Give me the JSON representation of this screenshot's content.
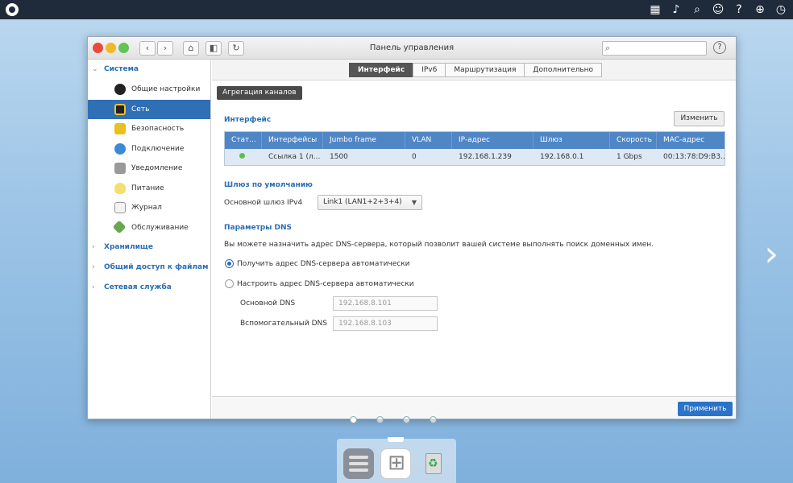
{
  "topbar": {
    "icons": [
      "apps-grid-icon",
      "bell-icon",
      "search-icon",
      "user-icon",
      "help-icon",
      "globe-icon",
      "dashboard-icon"
    ]
  },
  "window": {
    "title": "Панель управления",
    "search_placeholder": "",
    "help_label": "?"
  },
  "sidebar": {
    "groups": [
      {
        "label": "Система",
        "expanded": true
      },
      {
        "label": "Хранилище"
      },
      {
        "label": "Общий доступ к файлам"
      },
      {
        "label": "Сетевая служба"
      }
    ],
    "items": [
      {
        "label": "Общие настройки",
        "icon": "gear-icon"
      },
      {
        "label": "Сеть",
        "icon": "network-icon",
        "active": true
      },
      {
        "label": "Безопасность",
        "icon": "lock-icon"
      },
      {
        "label": "Подключение",
        "icon": "connection-icon"
      },
      {
        "label": "Уведомление",
        "icon": "notification-icon"
      },
      {
        "label": "Питание",
        "icon": "bulb-icon"
      },
      {
        "label": "Журнал",
        "icon": "log-icon"
      },
      {
        "label": "Обслуживание",
        "icon": "tools-icon"
      }
    ]
  },
  "tabs": [
    {
      "label": "Интерфейс",
      "active": true
    },
    {
      "label": "IPv6"
    },
    {
      "label": "Маршрутизация"
    },
    {
      "label": "Дополнительно"
    }
  ],
  "main": {
    "aggregation_button": "Агрегация каналов",
    "interface_title": "Интерфейс",
    "edit_button": "Изменить",
    "table": {
      "headers": [
        "Стат...",
        "Интерфейсы",
        "Jumbo frame",
        "VLAN",
        "IP-адрес",
        "Шлюз",
        "Скорость",
        "MAC-адрес"
      ],
      "rows": [
        [
          "",
          "Ссылка 1 (л...",
          "1500",
          "0",
          "192.168.1.239",
          "192.168.0.1",
          "1 Gbps",
          "00:13:78:D9:B3..."
        ]
      ],
      "status_color": "#5fbf4a"
    },
    "gateway_title": "Шлюз по умолчанию",
    "gateway_label": "Основной шлюз IPv4",
    "gateway_value": "Link1 (LAN1+2+3+4)",
    "dns_title": "Параметры DNS",
    "dns_description": "Вы можете назначить адрес DNS-сервера, который позволит вашей системе выполнять поиск доменных имен.",
    "dns_option_auto": "Получить адрес DNS-сервера автоматически",
    "dns_option_manual": "Настроить адрес DNS-сервера автоматически",
    "primary_dns_label": "Основной DNS",
    "primary_dns_value": "192.168.8.101",
    "secondary_dns_label": "Вспомогательный DNS",
    "secondary_dns_value": "192.168.8.103",
    "apply_button": "Применить"
  },
  "colors": {
    "accent": "#2f6fb6",
    "header_blue": "#4f86c6",
    "topbar": "#1f2a3a"
  }
}
